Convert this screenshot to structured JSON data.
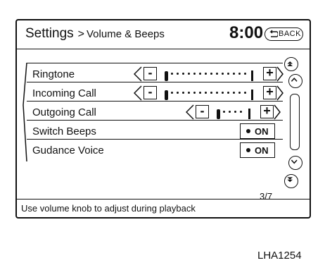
{
  "header": {
    "title": "Settings",
    "breadcrumb_sep": ">",
    "subtitle": "Volume & Beeps",
    "clock": "8:00",
    "back_label": "BACK"
  },
  "items": [
    {
      "label": "Ringtone",
      "type": "slider",
      "minus": "-",
      "plus": "+"
    },
    {
      "label": "Incoming Call",
      "type": "slider",
      "minus": "-",
      "plus": "+"
    },
    {
      "label": "Outgoing Call",
      "type": "slider",
      "minus": "-",
      "plus": "+"
    },
    {
      "label": "Switch Beeps",
      "type": "toggle",
      "state": "ON"
    },
    {
      "label": "Gudance Voice",
      "type": "toggle",
      "state": "ON"
    }
  ],
  "page_indicator": "3/7",
  "footer_text": "Use volume knob to adjust during playback",
  "figure_code": "LHA1254",
  "icons": {
    "back": "back-arrow-icon",
    "scroll_up_fast": "double-chevron-up-icon",
    "scroll_up": "chevron-up-icon",
    "scroll_down": "chevron-down-icon",
    "scroll_down_fast": "double-chevron-down-icon"
  }
}
